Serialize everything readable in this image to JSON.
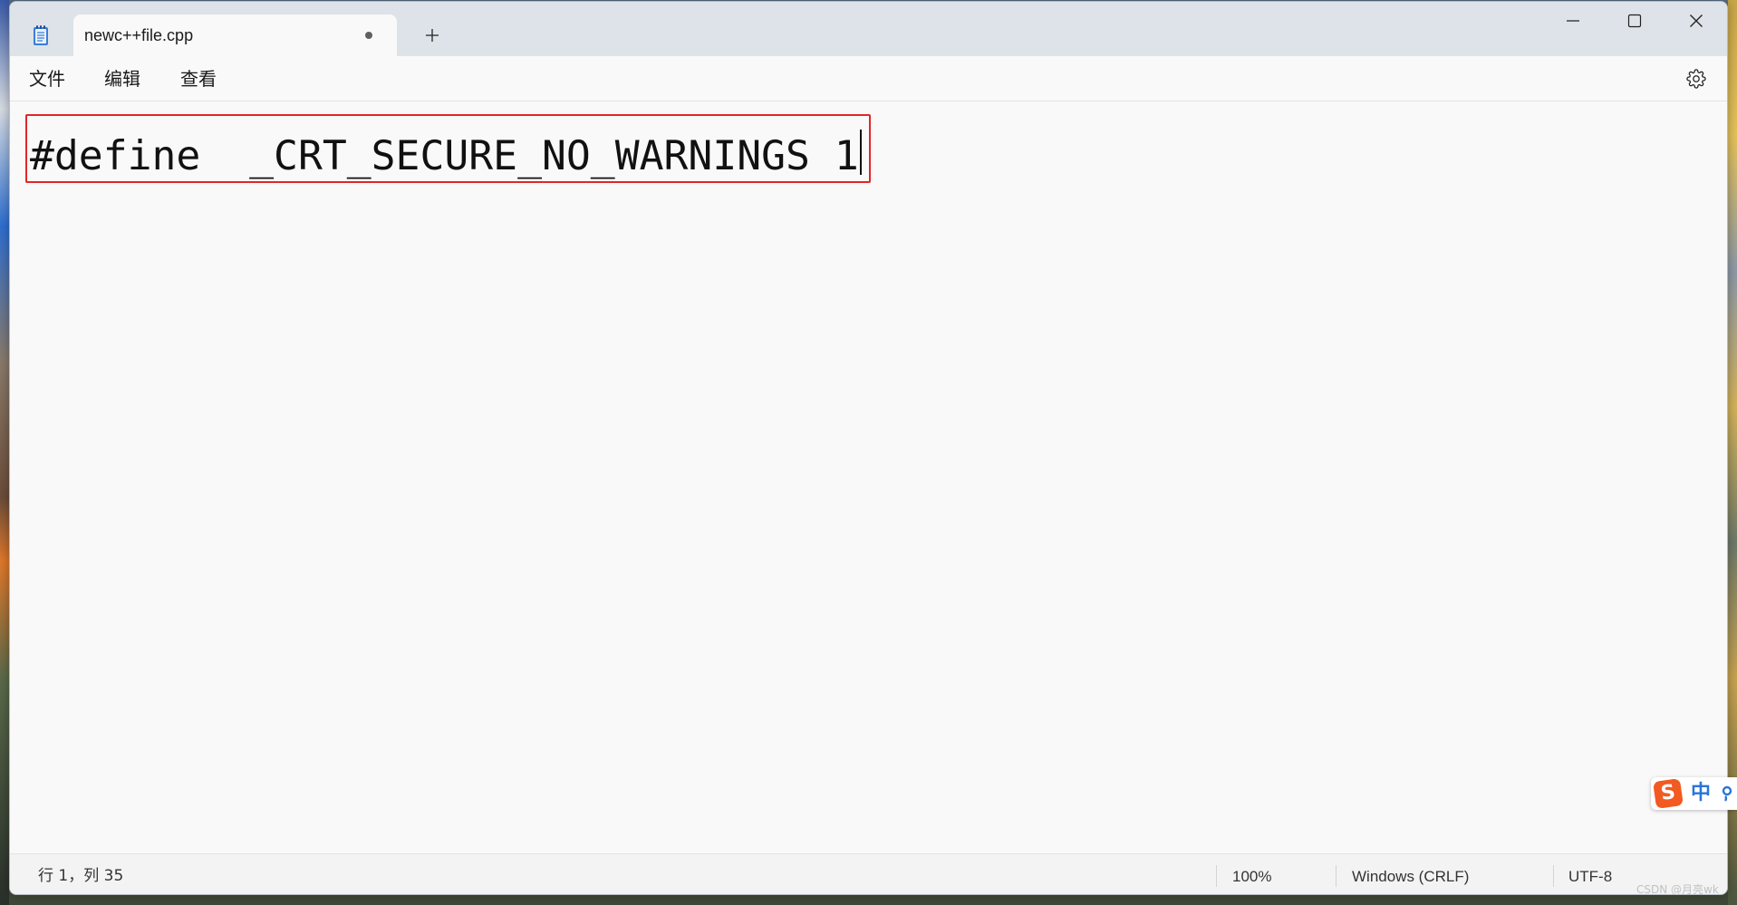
{
  "window": {
    "app_icon": "notepad-icon",
    "tab_title": "newc++file.cpp",
    "tab_unsaved_icon": "unsaved-dot-icon",
    "new_tab_icon": "plus-icon",
    "controls": {
      "minimize": "minimize-icon",
      "maximize": "maximize-icon",
      "close": "close-icon"
    }
  },
  "menu": {
    "items": [
      {
        "label": "文件"
      },
      {
        "label": "编辑"
      },
      {
        "label": "查看"
      }
    ],
    "settings_icon": "gear-icon"
  },
  "editor": {
    "content": "#define  _CRT_SECURE_NO_WARNINGS 1"
  },
  "status_bar": {
    "position": "行 1，列 35",
    "zoom": "100%",
    "line_ending": "Windows (CRLF)",
    "encoding": "UTF-8"
  },
  "ime_toolbar": {
    "logo_letter": "S",
    "mode": "中",
    "punctuation_icon": "punctuation-mode-icon"
  },
  "watermark": "CSDN @月亮wk",
  "colors": {
    "annotation_border": "#e32626",
    "ime_logo": "#f25a22",
    "ime_text": "#2a74d8"
  }
}
